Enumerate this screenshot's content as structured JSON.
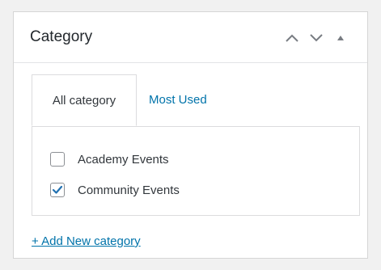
{
  "panel": {
    "title": "Category",
    "controls": [
      {
        "icon": "chevron-up-icon",
        "label": "Move up"
      },
      {
        "icon": "chevron-down-icon",
        "label": "Move down"
      },
      {
        "icon": "caret-up-icon",
        "label": "Toggle panel"
      }
    ]
  },
  "tabs": [
    {
      "label": "All category",
      "active": true
    },
    {
      "label": "Most Used",
      "active": false
    }
  ],
  "categories": [
    {
      "label": "Academy Events",
      "checked": false
    },
    {
      "label": "Community Events",
      "checked": true
    }
  ],
  "add_link": "+ Add New category",
  "colors": {
    "link": "#0073aa",
    "checkmark": "#2271b1",
    "border": "#dcdcde",
    "background": "#f1f1f1"
  }
}
